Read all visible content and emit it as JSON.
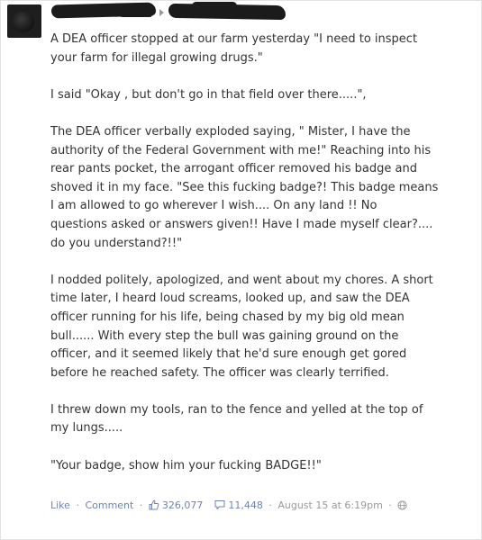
{
  "post": {
    "paragraphs": [
      "A DEA officer stopped at our farm yesterday \"I need to inspect\nyour farm for illegal growing drugs.\"",
      "I said \"Okay , but don't go in that field over there.....\",",
      "The DEA officer verbally exploded saying, \" Mister, I have the\nauthority of the Federal Government with me!\" Reaching into his\nrear pants pocket, the arrogant officer removed his badge and\nshoved it in my face. \"See this fucking badge?! This badge means\nI am allowed to go wherever I wish.... On any land !! No\nquestions asked or answers given!! Have I made myself clear?....\ndo you understand?!!\"",
      "I nodded politely, apologized, and went about my chores. A short\ntime later, I heard loud screams, looked up, and saw the DEA\nofficer running for his life, being chased by my big old mean\nbull...... With every step the bull was gaining ground on the\nofficer, and it seemed likely that he'd sure enough get gored\nbefore he reached safety. The officer was clearly terrified.",
      "I threw down my tools, ran to the fence and yelled at the top of\nmy lungs.....",
      "\"Your badge, show him your fucking BADGE!!\""
    ]
  },
  "actions": {
    "like_label": "Like",
    "comment_label": "Comment",
    "likes_count": "326,077",
    "comments_count": "11,448",
    "timestamp": "August 15 at 6:19pm",
    "separator": "·"
  },
  "icons": {
    "author_arrow": "arrow-right-icon",
    "like": "thumbs-up-icon",
    "comment": "comment-bubble-icon",
    "privacy": "globe-icon"
  },
  "colors": {
    "text": "#333333",
    "link": "#6d84b4",
    "meta": "#999999",
    "redaction": "#1b1b1b"
  }
}
